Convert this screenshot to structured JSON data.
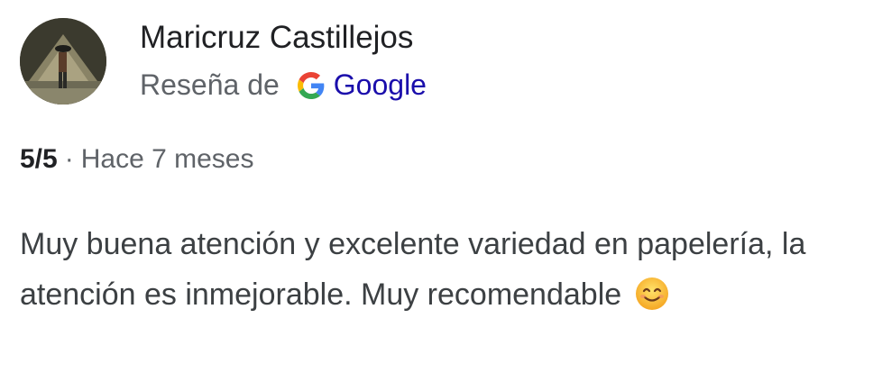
{
  "review": {
    "reviewer_name": "Maricruz Castillejos",
    "source_prefix": "Reseña de",
    "source_brand": "Google",
    "rating": "5/5",
    "separator": "·",
    "time_ago": "Hace 7 meses",
    "text": "Muy buena atención y excelente variedad en papelería, la atención es inmejorable. Muy recomendable",
    "emoji_icon": "smiling-face-icon",
    "avatar_icon": "reviewer-photo-avatar"
  },
  "colors": {
    "google_blue": "#4285F4",
    "google_red": "#EA4335",
    "google_yellow": "#FBBC05",
    "google_green": "#34A853",
    "link_blue": "#1a0dab"
  }
}
